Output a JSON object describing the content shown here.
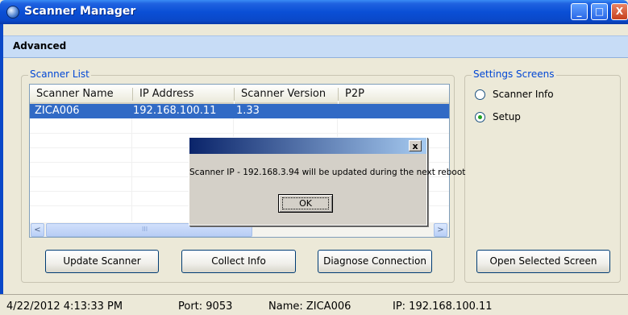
{
  "window": {
    "title": "Scanner Manager",
    "buttons": {
      "minimize": "_",
      "maximize": "□",
      "close": "X"
    }
  },
  "menu": {
    "advanced": "Advanced"
  },
  "scanner_list": {
    "label": "Scanner List",
    "columns": [
      "Scanner Name",
      "IP Address",
      "Scanner Version",
      "P2P"
    ],
    "rows": [
      {
        "name": "ZICA006",
        "ip": "192.168.100.11",
        "version": "1.33",
        "p2p": ""
      }
    ],
    "scroll": {
      "left": "<",
      "right": ">",
      "thumb": "III"
    }
  },
  "settings_screens": {
    "label": "Settings Screens",
    "options": [
      {
        "label": "Scanner Info",
        "selected": false
      },
      {
        "label": "Setup",
        "selected": true
      }
    ]
  },
  "buttons": {
    "update": "Update Scanner",
    "collect": "Collect Info",
    "diagnose": "Diagnose Connection",
    "open_selected": "Open Selected Screen"
  },
  "dialog": {
    "close": "x",
    "message": "Scanner IP - 192.168.3.94 will be updated during the next reboot",
    "ok": "OK"
  },
  "status": {
    "datetime": "4/22/2012 4:13:33 PM",
    "port": "Port: 9053",
    "name": "Name: ZICA006",
    "ip": "IP: 192.168.100.11"
  },
  "colors": {
    "titlebar": "#0a4fd6",
    "selection": "#316ac5",
    "group_label": "#0046d5",
    "menu_strip": "#c7dcf6"
  }
}
